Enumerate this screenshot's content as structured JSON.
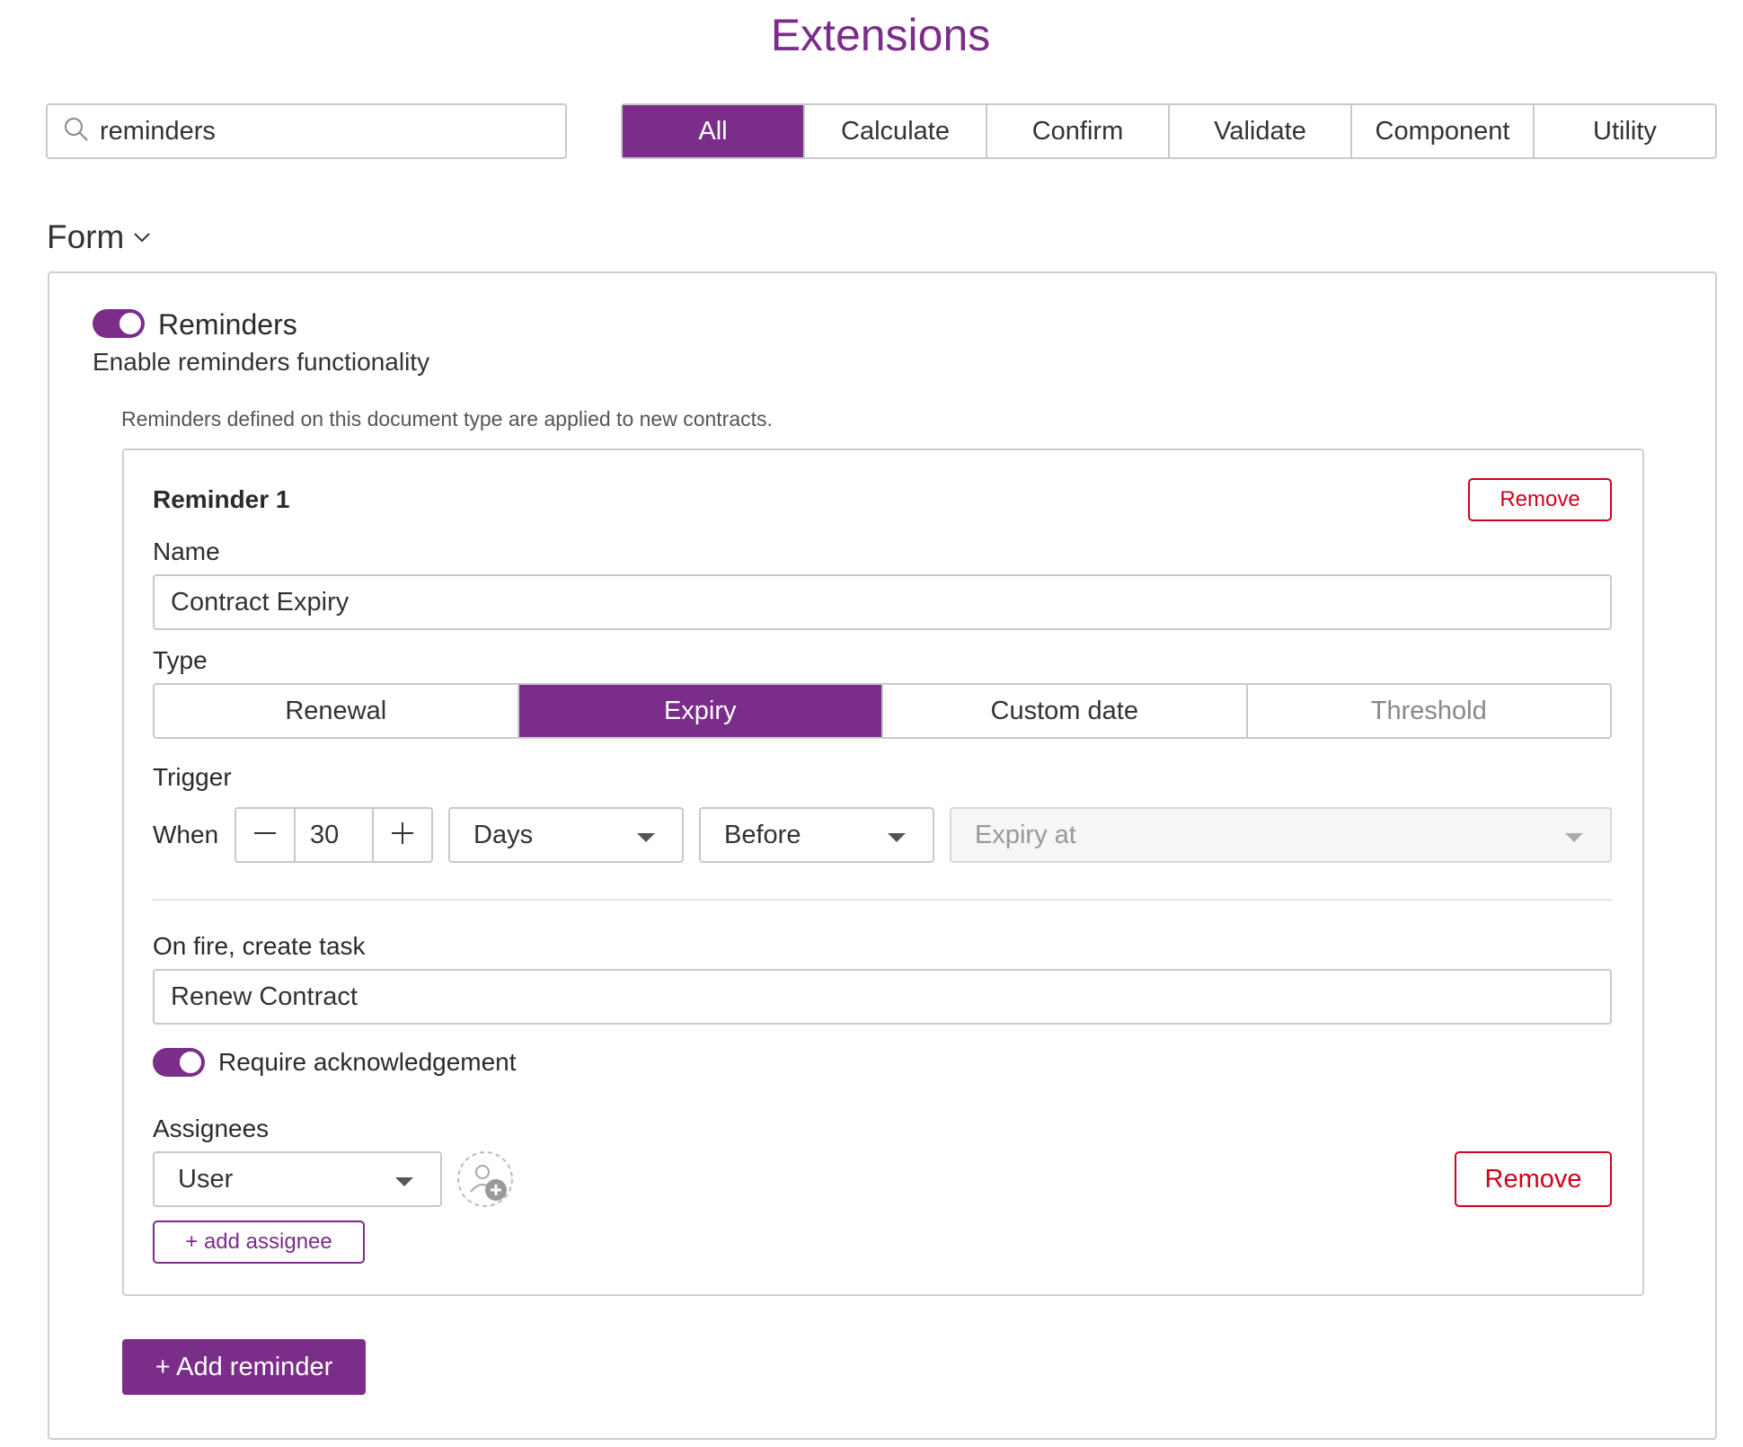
{
  "page": {
    "title": "Extensions"
  },
  "search": {
    "value": "reminders"
  },
  "filters": [
    {
      "label": "All",
      "active": true
    },
    {
      "label": "Calculate"
    },
    {
      "label": "Confirm"
    },
    {
      "label": "Validate"
    },
    {
      "label": "Component"
    },
    {
      "label": "Utility"
    }
  ],
  "section": {
    "title": "Form"
  },
  "reminders": {
    "enabled": true,
    "title": "Reminders",
    "description": "Enable reminders functionality",
    "note": "Reminders defined on this document type are applied to new contracts."
  },
  "reminder1": {
    "title": "Reminder 1",
    "remove_label": "Remove",
    "name_label": "Name",
    "name_value": "Contract Expiry",
    "type_label": "Type",
    "types": [
      {
        "label": "Renewal"
      },
      {
        "label": "Expiry",
        "active": true
      },
      {
        "label": "Custom date"
      },
      {
        "label": "Threshold",
        "muted": true
      }
    ],
    "trigger_label": "Trigger",
    "when_label": "When",
    "amount": "30",
    "unit": "Days",
    "direction": "Before",
    "event": "Expiry at",
    "task_label": "On fire, create task",
    "task_value": "Renew Contract",
    "ack_label": "Require acknowledgement",
    "ack_enabled": true,
    "assignees_label": "Assignees",
    "assignee_type": "User",
    "assignee_remove_label": "Remove",
    "add_assignee_label": "+ add assignee"
  },
  "add_reminder_label": "+ Add reminder",
  "colors": {
    "accent": "#7b2d8a",
    "danger": "#d0021b",
    "border": "#c9c9c9"
  }
}
